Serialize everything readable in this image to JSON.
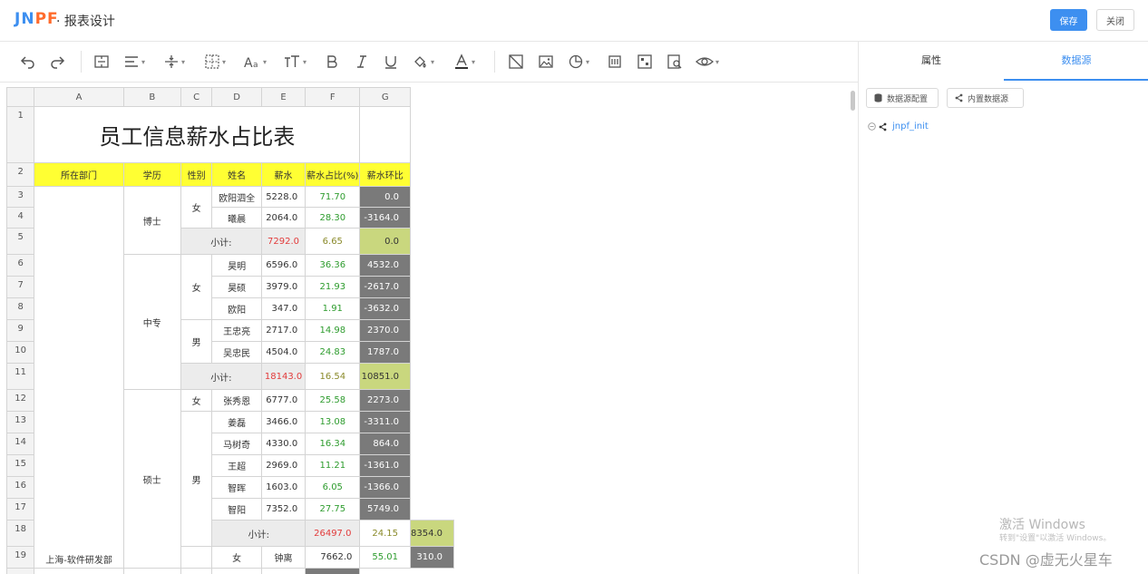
{
  "header": {
    "logo": {
      "a": "JN",
      "b": "PF"
    },
    "title": "· 报表设计",
    "save_label": "保存",
    "close_label": "关闭"
  },
  "right_panel": {
    "tabs": [
      {
        "label": "属性"
      },
      {
        "label": "数据源"
      }
    ],
    "active_tab": 1,
    "btn_config": "数据源配置",
    "btn_builtin": "内置数据源",
    "tree": {
      "label": "jnpf_init"
    }
  },
  "sheet": {
    "columns": [
      "A",
      "B",
      "C",
      "D",
      "E",
      "F",
      "G"
    ],
    "title": "员工信息薪水占比表",
    "headers": [
      "所在部门",
      "学历",
      "性别",
      "姓名",
      "薪水",
      "薪水占比(%)",
      "薪水环比"
    ],
    "dept": "上海-软件研发部",
    "subtotal_label": "小计:",
    "edu": [
      "博士",
      "中专",
      "硕士"
    ],
    "gender": {
      "female": "女",
      "male": "男"
    },
    "rows": [
      {
        "r": "3",
        "name": "欧阳泗全",
        "salary": "5228.0",
        "pct": "71.70",
        "ring": "0.0"
      },
      {
        "r": "4",
        "name": "曦晨",
        "salary": "2064.0",
        "pct": "28.30",
        "ring": "-3164.0"
      },
      {
        "r": "5",
        "sub": true,
        "salary": "7292.0",
        "pct": "6.65",
        "ring": "0.0"
      },
      {
        "r": "6",
        "name": "昊明",
        "salary": "6596.0",
        "pct": "36.36",
        "ring": "4532.0"
      },
      {
        "r": "7",
        "name": "昊硕",
        "salary": "3979.0",
        "pct": "21.93",
        "ring": "-2617.0"
      },
      {
        "r": "8",
        "name": "欧阳",
        "salary": "347.0",
        "pct": "1.91",
        "ring": "-3632.0"
      },
      {
        "r": "9",
        "name": "王忠亮",
        "salary": "2717.0",
        "pct": "14.98",
        "ring": "2370.0"
      },
      {
        "r": "10",
        "name": "吴忠民",
        "salary": "4504.0",
        "pct": "24.83",
        "ring": "1787.0"
      },
      {
        "r": "11",
        "sub": true,
        "salary": "18143.0",
        "pct": "16.54",
        "ring": "10851.0"
      },
      {
        "r": "12",
        "name": "张秀恩",
        "salary": "6777.0",
        "pct": "25.58",
        "ring": "2273.0"
      },
      {
        "r": "13",
        "name": "姜磊",
        "salary": "3466.0",
        "pct": "13.08",
        "ring": "-3311.0"
      },
      {
        "r": "14",
        "name": "马树奇",
        "salary": "4330.0",
        "pct": "16.34",
        "ring": "864.0"
      },
      {
        "r": "15",
        "name": "王超",
        "salary": "2969.0",
        "pct": "11.21",
        "ring": "-1361.0"
      },
      {
        "r": "16",
        "name": "智晖",
        "salary": "1603.0",
        "pct": "6.05",
        "ring": "-1366.0"
      },
      {
        "r": "17",
        "name": "智阳",
        "salary": "7352.0",
        "pct": "27.75",
        "ring": "5749.0"
      },
      {
        "r": "18",
        "sub": true,
        "salary": "26497.0",
        "pct": "24.15",
        "ring": "8354.0"
      },
      {
        "r": "19",
        "name": "钟离",
        "salary": "7662.0",
        "pct": "55.01",
        "ring": "310.0"
      }
    ]
  },
  "overlay": {
    "win1": "激活 Windows",
    "win2": "转到\"设置\"以激活 Windows。",
    "csdn": "CSDN @虚无火星车"
  }
}
